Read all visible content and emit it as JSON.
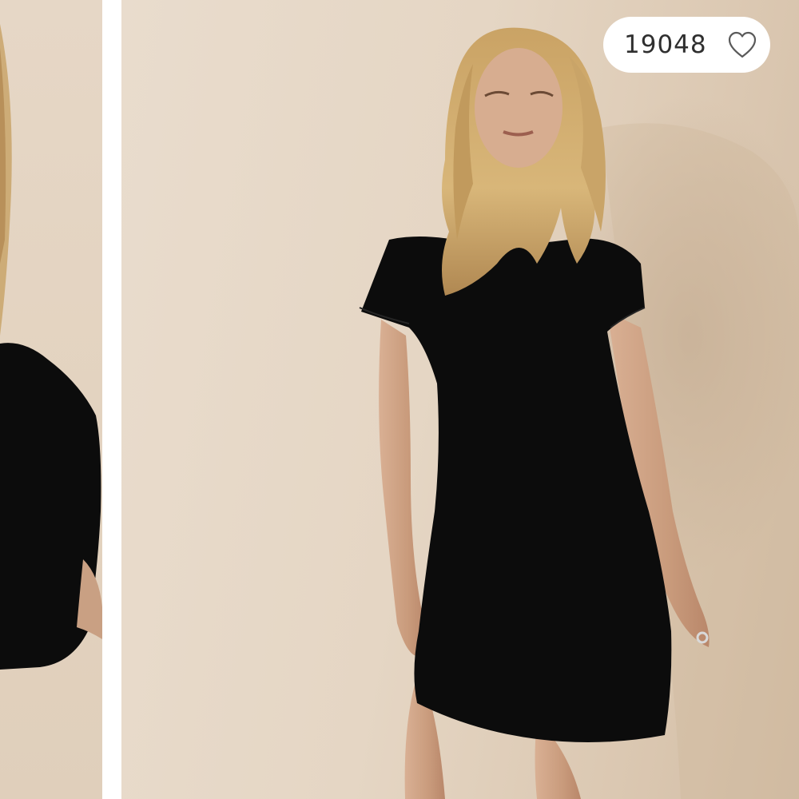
{
  "product_gallery": {
    "like_count": "19048",
    "icons": {
      "like": "heart-outline-icon"
    },
    "colors": {
      "backdrop": "#e6d8c8",
      "dress": "#0c0c0c",
      "pill_background": "#ffffff",
      "pill_text": "#2f2f2f"
    }
  }
}
